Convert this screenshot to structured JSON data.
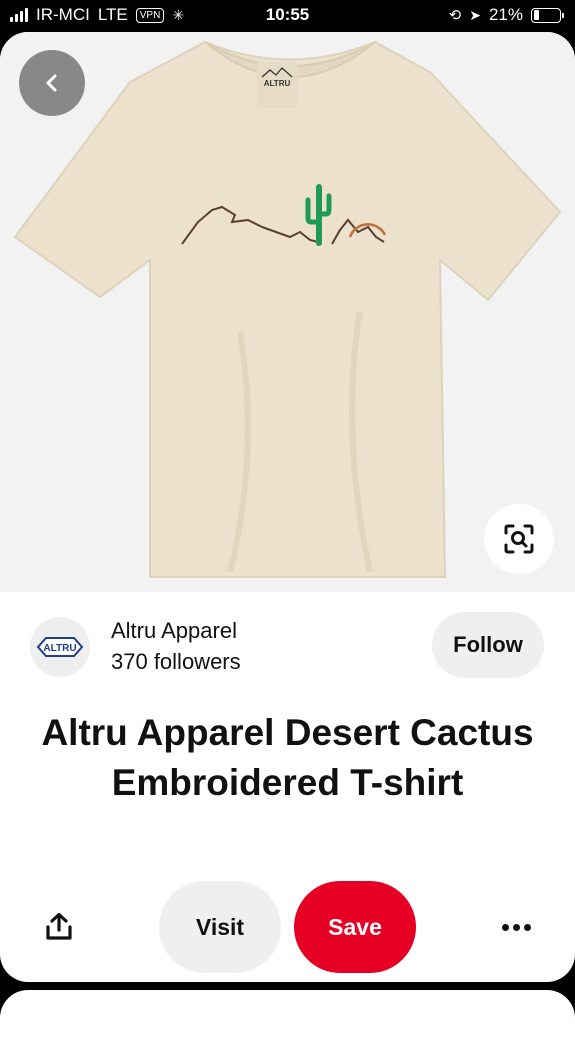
{
  "status_bar": {
    "carrier": "IR-MCI",
    "network": "LTE",
    "vpn": "VPN",
    "time": "10:55",
    "battery": "21%",
    "battery_level": 0.21
  },
  "pin": {
    "creator_name": "Altru Apparel",
    "followers": "370 followers",
    "follow_label": "Follow",
    "title": "Altru Apparel Desert Cactus Embroidered T-shirt",
    "visit_label": "Visit",
    "save_label": "Save",
    "tag_brand": "ALTRU",
    "avatar_logo": "ALTRU"
  },
  "icons": {
    "back": "chevron-left-icon",
    "lens": "visual-search-icon",
    "share": "share-icon",
    "more": "more-icon"
  },
  "colors": {
    "save": "#e60023",
    "shirt": "#ebe1cc",
    "cactus": "#1f9a55",
    "sun": "#c0703a"
  }
}
